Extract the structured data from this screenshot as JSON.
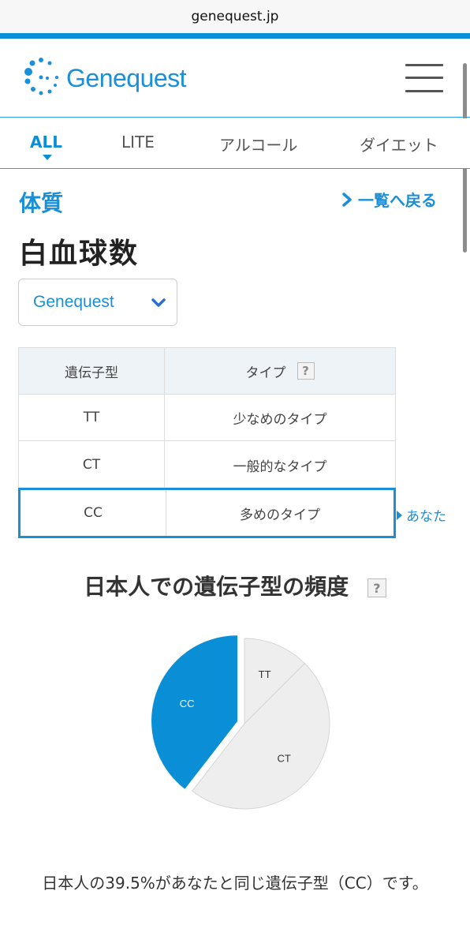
{
  "browser": {
    "url": "genequest.jp"
  },
  "header": {
    "logo_text": "Genequest"
  },
  "tabs": [
    {
      "label": "ALL",
      "active": true
    },
    {
      "label": "LITE"
    },
    {
      "label": "アルコール"
    },
    {
      "label": "ダイエット"
    }
  ],
  "page": {
    "category": "体質",
    "back_link": "一覧へ戻る",
    "title": "白血球数",
    "source_select": "Genequest"
  },
  "genotype_table": {
    "headers": [
      "遺伝子型",
      "タイプ"
    ],
    "rows": [
      {
        "genotype": "TT",
        "type": "少なめのタイプ"
      },
      {
        "genotype": "CT",
        "type": "一般的なタイプ"
      },
      {
        "genotype": "CC",
        "type": "多めのタイプ"
      }
    ],
    "you_label": "あなた",
    "help_mark": "?"
  },
  "frequency": {
    "title": "日本人での遺伝子型の頻度",
    "help_mark": "?"
  },
  "chart_data": {
    "type": "pie",
    "categories": [
      "TT",
      "CT",
      "CC"
    ],
    "values": [
      12.5,
      48.0,
      39.5
    ],
    "unit": "%",
    "highlight": "CC",
    "colors": {
      "highlight": "#0a8fd6",
      "other": "#eeeeee"
    }
  },
  "summary": "日本人の39.5%があなたと同じ遺伝子型（CC）です。",
  "colors": {
    "accent": "#0a8fd6",
    "title": "#222222"
  }
}
